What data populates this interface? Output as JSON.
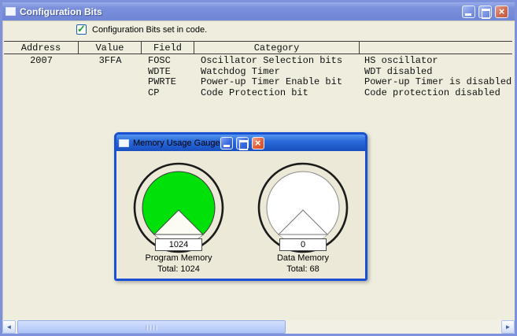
{
  "window": {
    "title": "Configuration Bits"
  },
  "checkbox": {
    "label": "Configuration Bits set in code.",
    "checked": true
  },
  "table": {
    "headers": [
      "Address",
      "Value",
      "Field",
      "Category",
      ""
    ],
    "rows": [
      {
        "address": "2007",
        "value": "3FFA",
        "field": "FOSC",
        "category": "Oscillator Selection bits",
        "setting": "HS oscillator"
      },
      {
        "address": "",
        "value": "",
        "field": "WDTE",
        "category": "Watchdog Timer",
        "setting": "WDT disabled"
      },
      {
        "address": "",
        "value": "",
        "field": "PWRTE",
        "category": "Power-up Timer Enable bit",
        "setting": "Power-up Timer is disabled"
      },
      {
        "address": "",
        "value": "",
        "field": "CP",
        "category": "Code Protection bit",
        "setting": "Code protection disabled"
      }
    ]
  },
  "gauge_window": {
    "title": "Memory Usage Gauge",
    "gauges": [
      {
        "value": "1024",
        "label": "Program Memory",
        "total": "Total: 1024",
        "fill_color": "#00E109",
        "stroke_color": "#2A2A2A"
      },
      {
        "value": "0",
        "label": "Data Memory",
        "total": "Total: 68",
        "fill_color": "#FFFFFF",
        "stroke_color": "#8A8A8A"
      }
    ]
  },
  "icons": {
    "check": "✓",
    "close": "×",
    "scroll_left": "◄",
    "scroll_right": "►"
  },
  "colors": {
    "active_title_blue": "#2B6ADA",
    "inactive_title_blue": "#7B90DC",
    "window_border_blue": "#1A50D2",
    "client_beige": "#EFEDDE",
    "gauge_green": "#00E109"
  }
}
